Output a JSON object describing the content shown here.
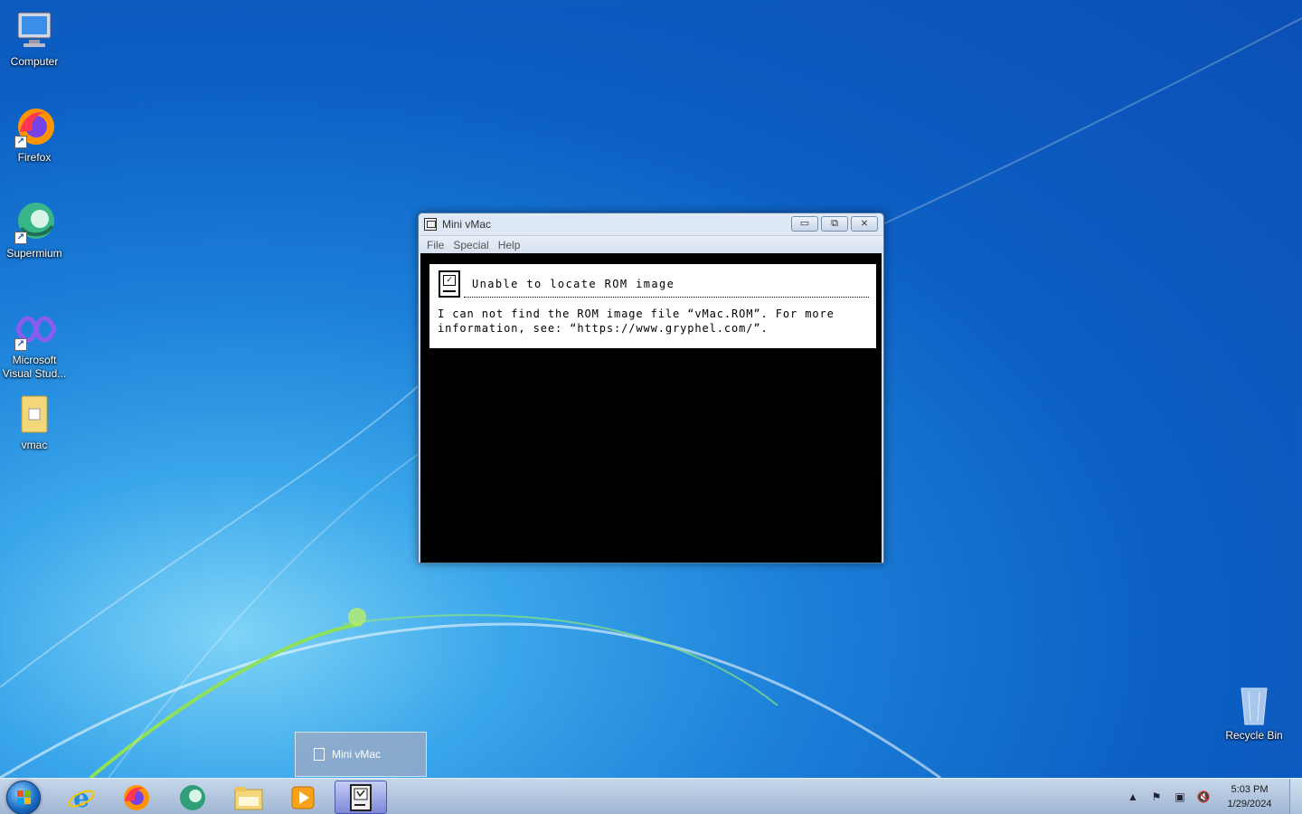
{
  "desktop": {
    "icons": [
      {
        "label": "Computer",
        "icon": "computer-icon"
      },
      {
        "label": "Firefox",
        "icon": "firefox-icon"
      },
      {
        "label": "Supermium",
        "icon": "supermium-icon"
      },
      {
        "label": "Microsoft Visual Stud...",
        "icon": "visual-studio-icon"
      },
      {
        "label": "vmac",
        "icon": "folder-icon"
      },
      {
        "label": "Recycle Bin",
        "icon": "recycle-bin-icon"
      }
    ]
  },
  "window": {
    "title": "Mini vMac",
    "menu": [
      "File",
      "Special",
      "Help"
    ],
    "controls": {
      "minimize": "▭",
      "maximize": "⧉",
      "close": "⨯"
    },
    "alert": {
      "title": "Unable to locate ROM image",
      "body_line1": "I can not find the ROM image file “vMac.ROM”. For more",
      "body_line2": "information, see: “https://www.gryphel.com/”."
    }
  },
  "taskbar": {
    "thumbnail_label": "Mini vMac",
    "pinned": [
      "internet-explorer-icon",
      "firefox-icon",
      "supermium-icon",
      "file-explorer-icon",
      "media-player-icon",
      "mini-vmac-icon"
    ],
    "clock_time": "5:03 PM",
    "clock_date": "1/29/2024"
  },
  "colors": {
    "wallpaper": "#0c5fc4",
    "screen": "#000000",
    "accent": "#1b7fd8"
  }
}
